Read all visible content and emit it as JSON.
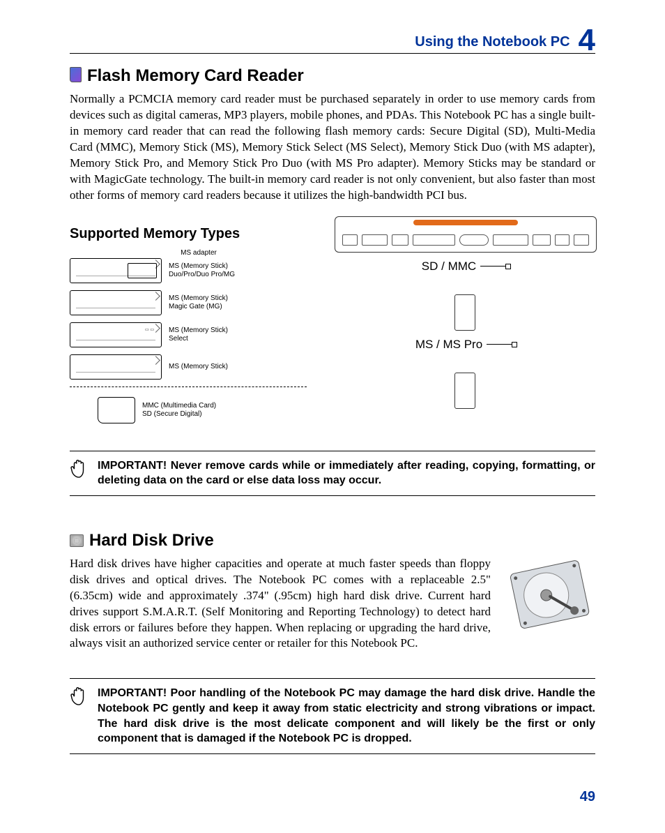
{
  "header": {
    "title": "Using the Notebook PC",
    "chapter": "4"
  },
  "section1": {
    "title": "Flash Memory Card Reader",
    "body": "Normally a PCMCIA memory card reader must be purchased separately in order to use memory cards from devices such as digital cameras, MP3 players, mobile phones, and PDAs. This Notebook PC has a single built-in memory card reader that can read the following flash memory cards: Secure Digital (SD), Multi-Media Card (MMC), Memory Stick (MS), Memory Stick Select (MS Select), Memory Stick Duo (with MS adapter), Memory Stick Pro, and Memory Stick Pro Duo (with MS Pro adapter). Memory Sticks may be standard or with MagicGate technology. The built-in memory card reader is not only convenient, but also faster than most other forms of memory card readers because it utilizes the high-bandwidth PCI bus."
  },
  "subhead": "Supported Memory Types",
  "memory_types": {
    "adapter_label": "MS adapter",
    "rows": [
      {
        "label": "MS (Memory Stick)\nDuo/Pro/Duo Pro/MG"
      },
      {
        "label": "MS (Memory Stick)\nMagic Gate (MG)"
      },
      {
        "label": "MS (Memory Stick)\nSelect"
      },
      {
        "label": "MS (Memory Stick)"
      }
    ],
    "bottom": {
      "label": "MMC (Multimedia Card)\nSD (Secure Digital)"
    }
  },
  "slots": {
    "top": "SD / MMC",
    "bottom": "MS / MS Pro"
  },
  "callout1": "IMPORTANT!  Never remove cards while or immediately after reading, copying, formatting, or deleting data on the card or else data loss may occur.",
  "section2": {
    "title": "Hard Disk Drive",
    "body": "Hard disk drives have higher capacities and operate at much faster speeds than floppy disk drives and optical drives. The Notebook PC comes with a replaceable 2.5\" (6.35cm) wide and approximately .374\" (.95cm) high hard disk drive. Current hard drives support S.M.A.R.T. (Self Monitoring and Reporting Technology) to detect hard disk errors or failures before they happen. When replacing or upgrading the hard drive, always visit an authorized service center or retailer for this Notebook PC."
  },
  "callout2": "IMPORTANT!  Poor handling of the Notebook PC may damage the hard disk drive. Handle the Notebook PC gently and keep it away from static electricity and strong vibrations or impact. The hard disk drive is the most delicate component and will likely be the first or only component that is damaged if the Notebook PC is dropped.",
  "page_number": "49"
}
